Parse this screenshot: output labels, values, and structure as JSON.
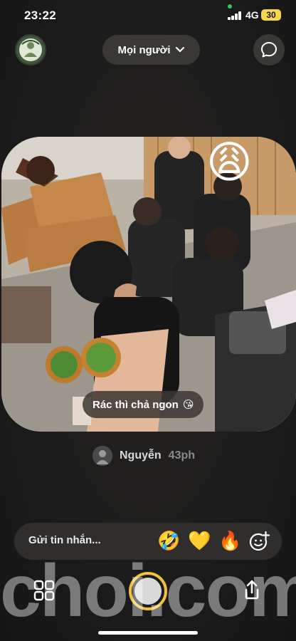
{
  "status_bar": {
    "time": "23:22",
    "network": "4G",
    "battery": "30"
  },
  "header": {
    "audience_label": "Mọi người",
    "avatar_icon": "user-avatar-icon",
    "chat_icon": "chat-bubble-icon"
  },
  "post": {
    "caption": "Rác thì chả ngon",
    "caption_emoji": "😘",
    "overlay_emoji": "😩",
    "author_name": "Nguyễn",
    "time_ago": "43ph"
  },
  "message_bar": {
    "placeholder": "Gửi tin nhắn...",
    "reactions": [
      "🤣",
      "💛",
      "🔥"
    ],
    "add_reaction_icon": "add-emoji-icon"
  },
  "bottom": {
    "watermark": "choi.com",
    "grid_icon": "grid-icon",
    "share_icon": "share-icon"
  },
  "colors": {
    "accent": "#f3c13a",
    "battery": "#f5d64a",
    "background": "#1b1b1b",
    "pill": "#3a3835"
  }
}
